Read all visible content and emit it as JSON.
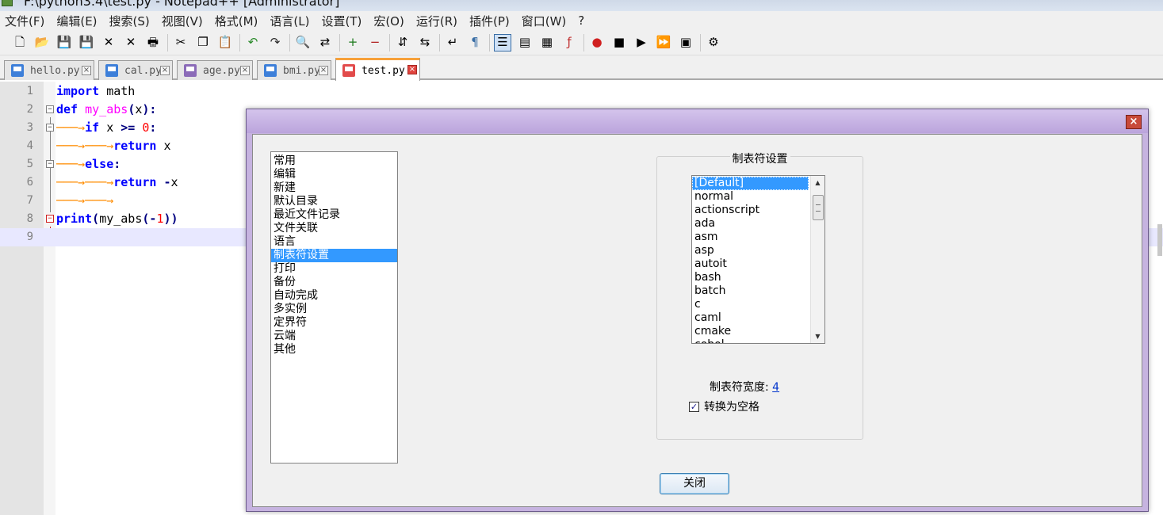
{
  "window": {
    "title": "F:\\python3.4\\test.py - Notepad++ [Administrator]"
  },
  "menu": [
    "文件(F)",
    "编辑(E)",
    "搜索(S)",
    "视图(V)",
    "格式(M)",
    "语言(L)",
    "设置(T)",
    "宏(O)",
    "运行(R)",
    "插件(P)",
    "窗口(W)",
    "?"
  ],
  "toolbar": {
    "groups": [
      [
        "new-file-icon",
        "open-file-icon",
        "save-icon",
        "save-all-icon",
        "close-icon",
        "close-all-icon",
        "print-icon"
      ],
      [
        "cut-icon",
        "copy-icon",
        "paste-icon"
      ],
      [
        "undo-icon",
        "redo-icon"
      ],
      [
        "find-icon",
        "replace-icon"
      ],
      [
        "zoom-in-icon",
        "zoom-out-icon"
      ],
      [
        "sync-vertical-icon",
        "sync-horizontal-icon"
      ],
      [
        "word-wrap-icon",
        "show-all-chars-icon"
      ],
      [
        "indent-guide-icon",
        "user-define-icon",
        "doc-map-icon",
        "function-list-icon"
      ],
      [
        "record-macro-icon",
        "stop-record-icon",
        "play-macro-icon",
        "run-macro-multiple-icon",
        "save-macro-icon"
      ],
      [
        "plugin-icon"
      ]
    ],
    "active": "indent-guide-icon"
  },
  "tabs": [
    {
      "label": "hello.py",
      "icon": "blue"
    },
    {
      "label": "cal.py",
      "icon": "blue"
    },
    {
      "label": "age.py",
      "icon": "purple"
    },
    {
      "label": "bmi.py",
      "icon": "blue"
    },
    {
      "label": "test.py",
      "icon": "red",
      "active": true
    }
  ],
  "editor": {
    "lines": [
      {
        "no": "1",
        "text": "import math"
      },
      {
        "no": "2",
        "text": "def my_abs(x):"
      },
      {
        "no": "3",
        "text": "    if x >= 0:"
      },
      {
        "no": "4",
        "text": "        return x"
      },
      {
        "no": "5",
        "text": "    else:"
      },
      {
        "no": "6",
        "text": "        return -x"
      },
      {
        "no": "7",
        "text": ""
      },
      {
        "no": "8",
        "text": "print(my_abs(-1))"
      },
      {
        "no": "9",
        "text": ""
      }
    ],
    "current_line": 9
  },
  "dialog": {
    "close_icon": "×",
    "categories": [
      "常用",
      "编辑",
      "新建",
      "默认目录",
      "最近文件记录",
      "文件关联",
      "语言",
      "制表符设置",
      "打印",
      "备份",
      "自动完成",
      "多实例",
      "定界符",
      "云端",
      "其他"
    ],
    "selected_category": "制表符设置",
    "tab_settings": {
      "group_title": "制表符设置",
      "languages": [
        "[Default]",
        "normal",
        "actionscript",
        "ada",
        "asm",
        "asp",
        "autoit",
        "bash",
        "batch",
        "c",
        "caml",
        "cmake",
        "cobol"
      ],
      "selected_language": "[Default]",
      "tab_width_label": "制表符宽度:",
      "tab_width_value": "4",
      "convert_to_spaces_label": "转换为空格",
      "convert_to_spaces_checked": true
    },
    "close_button": "关闭"
  }
}
